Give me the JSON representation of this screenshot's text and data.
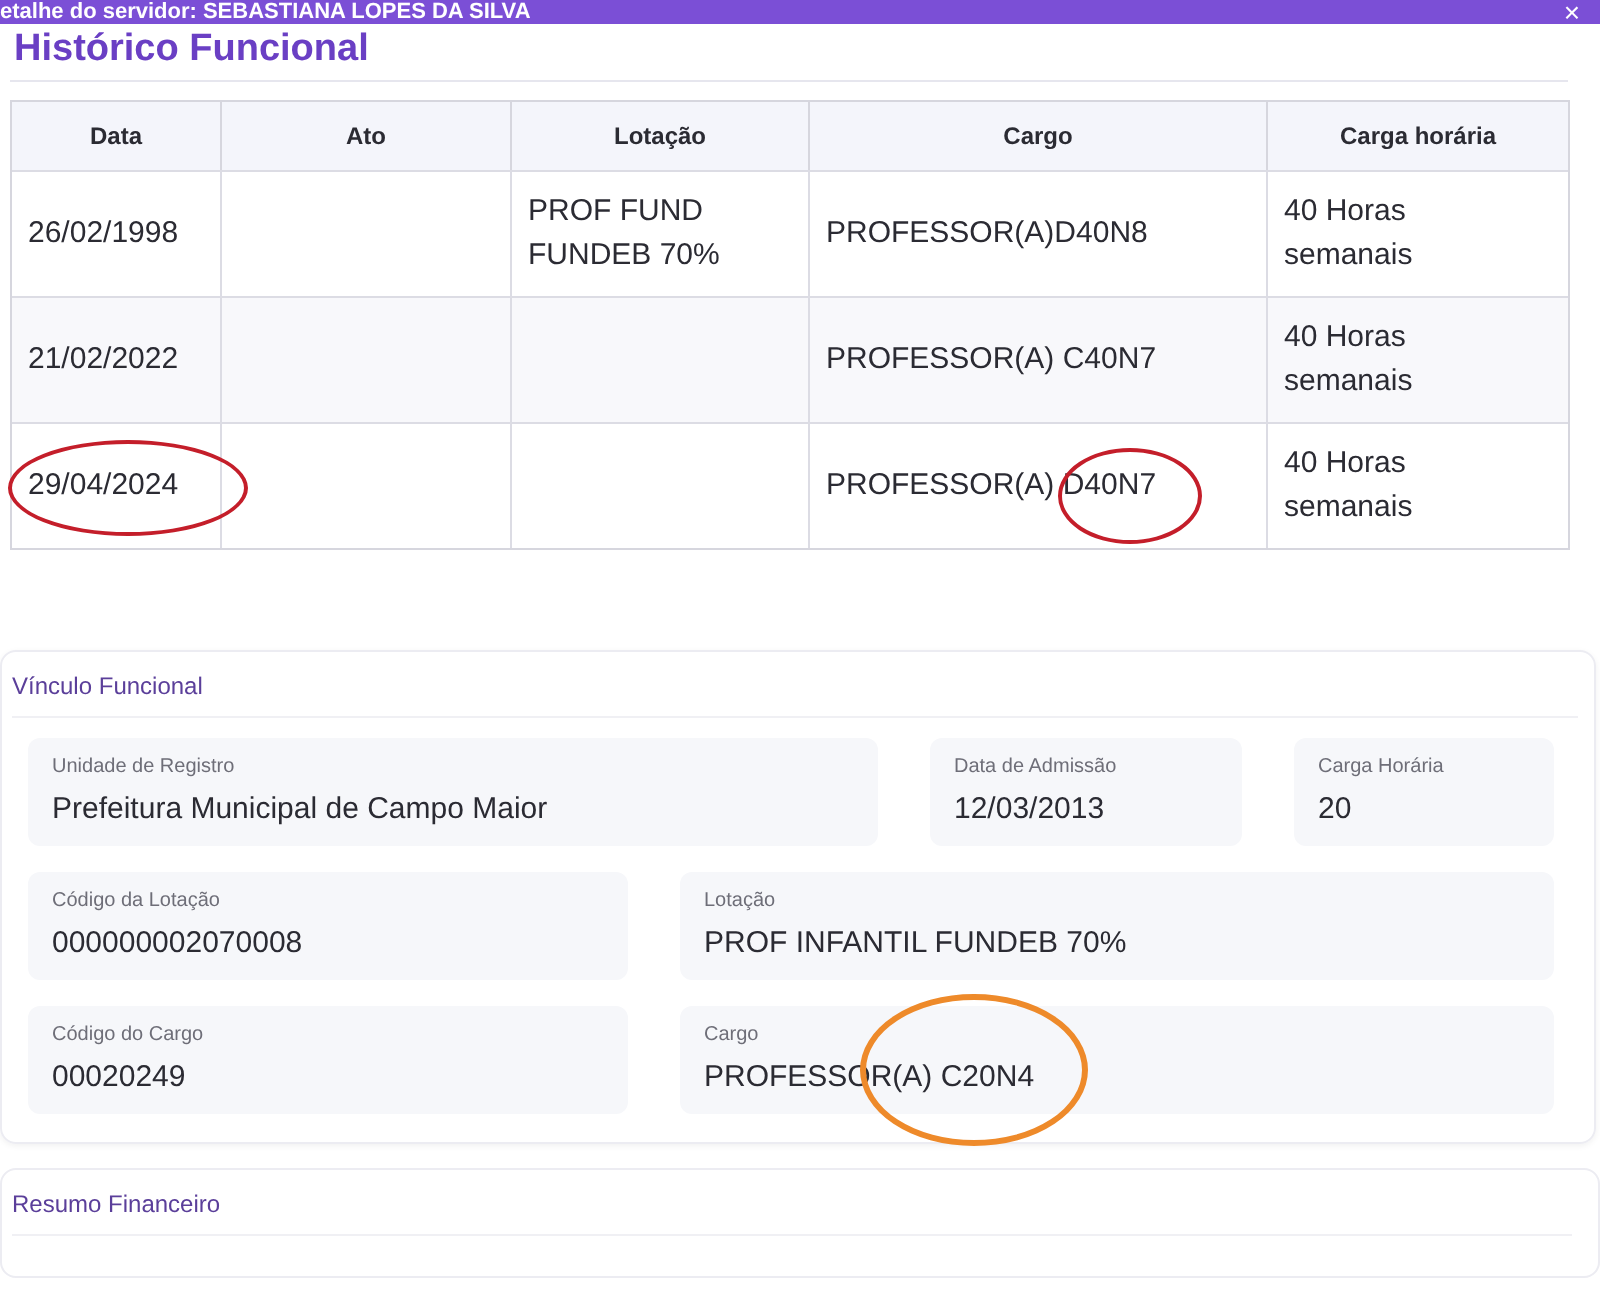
{
  "window": {
    "title": "etalhe do servidor: SEBASTIANA LOPES DA SILVA",
    "close": "×"
  },
  "historico": {
    "title": "Histórico Funcional",
    "columns": [
      "Data",
      "Ato",
      "Lotação",
      "Cargo",
      "Carga horária"
    ],
    "rows": [
      {
        "data": "26/02/1998",
        "ato": "",
        "lotacao": "PROF FUND FUNDEB 70%",
        "cargo": "PROFESSOR(A)D40N8",
        "carga": "40 Horas semanais",
        "circled_data": false,
        "circled_cargo": false
      },
      {
        "data": "21/02/2022",
        "ato": "",
        "lotacao": "",
        "cargo": "PROFESSOR(A) C40N7",
        "carga": "40 Horas semanais",
        "circled_data": false,
        "circled_cargo": false
      },
      {
        "data": "29/04/2024",
        "ato": "",
        "lotacao": "",
        "cargo": "PROFESSOR(A) D40N7",
        "carga": "40 Horas semanais",
        "circled_data": true,
        "circled_cargo": true
      }
    ]
  },
  "vinculo": {
    "title": "Vínculo Funcional",
    "rows": [
      [
        {
          "label": "Unidade de Registro",
          "value": "Prefeitura Municipal de Campo Maior",
          "circled": false
        },
        {
          "label": "Data de Admissão",
          "value": "12/03/2013",
          "circled": false
        },
        {
          "label": "Carga Horária",
          "value": "20",
          "circled": false
        }
      ],
      [
        {
          "label": "Código da Lotação",
          "value": "000000002070008",
          "circled": false
        },
        {
          "label": "Lotação",
          "value": "PROF INFANTIL FUNDEB 70%",
          "circled": false
        }
      ],
      [
        {
          "label": "Código do Cargo",
          "value": "00020249",
          "circled": false
        },
        {
          "label": "Cargo",
          "value": "PROFESSOR(A) C20N4",
          "circled": true
        }
      ]
    ]
  },
  "resumo": {
    "title": "Resumo Financeiro"
  }
}
